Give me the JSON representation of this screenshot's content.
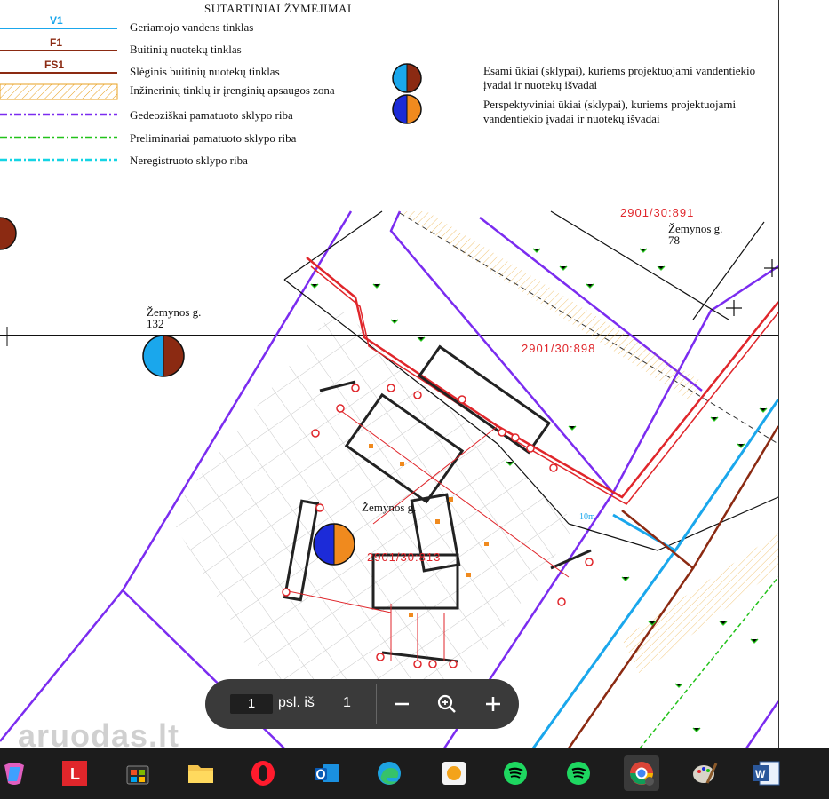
{
  "legend": {
    "title": "SUTARTINIAI ŽYMĖJIMAI",
    "items": [
      {
        "code": "V1",
        "label": "Geriamojo vandens tinklas",
        "color": "#1aa7ec"
      },
      {
        "code": "F1",
        "label": "Buitinių nuotekų tinklas",
        "color": "#8b2a12"
      },
      {
        "code": "FS1",
        "label": "Slėginis buitinių nuotekų tinklas",
        "color": "#8b2a12"
      },
      {
        "code": "",
        "label": "Inžinerinių tinklų ir įrenginių apsaugos zona",
        "color": "#e8a020"
      },
      {
        "code": "",
        "label": "Gedeoziškai pamatuoto sklypo riba",
        "color": "#7b2cf0"
      },
      {
        "code": "",
        "label": "Preliminariai pamatuoto sklypo riba",
        "color": "#22c21a"
      },
      {
        "code": "",
        "label": "Neregistruoto sklypo riba",
        "color": "#14d4e4"
      }
    ],
    "existing": "Esami ūkiai (sklypai), kuriems projektuojami vandentiekio įvadai ir nuotekų išvadai",
    "prospective": "Perspektyviniai ūkiai (sklypai), kuriems projektuojami vandentiekio įvadai ir nuotekų išvadai"
  },
  "map": {
    "street_132": "Žemynos g.",
    "number_132": "132",
    "street_78": "Žemynos g.",
    "number_78": "78",
    "street_center": "Žemynos g.",
    "parcel_top": "2901/30:891",
    "parcel_mid": "2901/30:898",
    "parcel_center": "2901/30:813",
    "pipe_len": "10m"
  },
  "toolbar": {
    "page_current": "1",
    "page_of": "psl. iš",
    "page_total": "1",
    "zoom_out_icon": "minus-icon",
    "zoom_fit_icon": "magnifier-icon",
    "zoom_in_icon": "plus-icon"
  },
  "watermark": "aruodas.lt",
  "taskbar": {
    "apps": [
      "copilot-icon",
      "lexicon-icon",
      "store-icon",
      "file-explorer-icon",
      "opera-icon",
      "outlook-icon",
      "edge-icon",
      "paint-icon",
      "spotify-icon",
      "spotify-icon",
      "chrome-icon",
      "palette-icon",
      "word-icon"
    ]
  },
  "colors": {
    "purple": "#7b2cf0",
    "red": "#e0262b",
    "cyan": "#1aa7ec",
    "brown": "#8b2a12",
    "green": "#22c21a",
    "orange": "#f08a1e",
    "blue": "#1c2bd8"
  }
}
